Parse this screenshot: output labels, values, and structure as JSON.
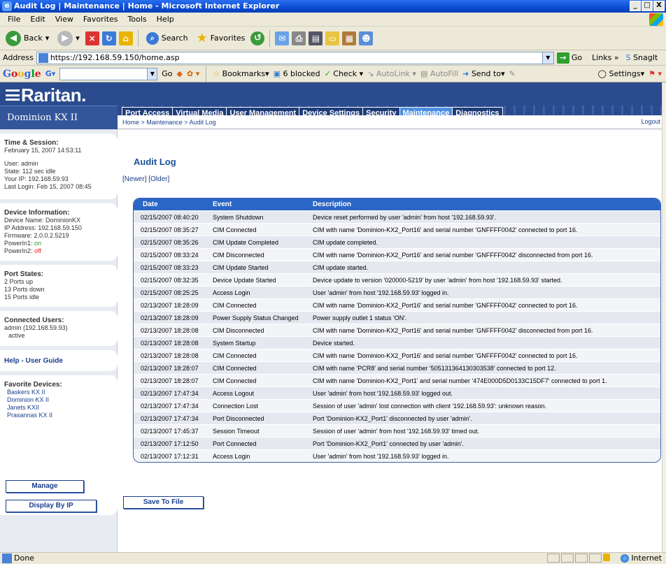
{
  "window": {
    "title": "Audit Log | Maintenance | Home - Microsoft Internet Explorer",
    "min": "_",
    "max": "□",
    "close": "X"
  },
  "menu": [
    "File",
    "Edit",
    "View",
    "Favorites",
    "Tools",
    "Help"
  ],
  "toolbar": {
    "back": "Back",
    "search": "Search",
    "favorites": "Favorites"
  },
  "address": {
    "label": "Address",
    "url": "https://192.168.59.150/home.asp",
    "go": "Go",
    "links": "Links",
    "snagit": "SnagIt"
  },
  "google_bar": {
    "logo": "Google",
    "go": "Go",
    "bookmarks": "Bookmarks▾",
    "blocked": "6 blocked",
    "check": "Check ▾",
    "autolink": "AutoLink ▾",
    "autofill": "AutoFill",
    "sendto": "Send to▾",
    "settings": "Settings▾"
  },
  "app": {
    "logo": "Raritan.",
    "product": "Dominion KX II",
    "tabs": [
      {
        "label": "Port Access",
        "active": false
      },
      {
        "label": "Virtual Media",
        "active": false
      },
      {
        "label": "User Management",
        "active": false
      },
      {
        "label": "Device Settings",
        "active": false
      },
      {
        "label": "Security",
        "active": false
      },
      {
        "label": "Maintenance",
        "active": true
      },
      {
        "label": "Diagnostics",
        "active": false
      }
    ],
    "breadcrumb": "Home > Maintenance > Audit Log",
    "logout": "Logout"
  },
  "sidebar": {
    "session": {
      "title": "Time & Session:",
      "datetime": "February 15, 2007 14:53:11",
      "user": "User: admin",
      "state": "State: 112 sec idle",
      "ip": "Your IP: 192.168.59.93",
      "last_login": "Last Login: Feb 15, 2007 08:45"
    },
    "device": {
      "title": "Device Information:",
      "name": "Device Name: DominionKX",
      "ip": "IP Address: 192.168.59.150",
      "firmware": "Firmware: 2.0.0.2.5219",
      "power1_label": "PowerIn1:",
      "power1_status": "on",
      "power2_label": "PowerIn2:",
      "power2_status": "off"
    },
    "ports": {
      "title": "Port States:",
      "up": "2 Ports up",
      "down": "13 Ports down",
      "idle": "15 Ports idle"
    },
    "users": {
      "title": "Connected Users:",
      "user": "admin (192.168.59.93)",
      "status": "active"
    },
    "help": "Help - User Guide",
    "favorites": {
      "title": "Favorite Devices:",
      "items": [
        "Baskers KX II",
        "Dominion KX II",
        "Janets KXII",
        "Prasannas KX II"
      ]
    },
    "manage": "Manage",
    "display_by_ip": "Display By IP"
  },
  "main": {
    "title": "Audit Log",
    "newer": "Newer",
    "older": "Older",
    "columns": {
      "date": "Date",
      "event": "Event",
      "description": "Description"
    },
    "rows": [
      {
        "date": "02/15/2007 08:40:20",
        "event": "System Shutdown",
        "desc": "Device reset performed by user 'admin' from host '192.168.59.93'."
      },
      {
        "date": "02/15/2007 08:35:27",
        "event": "CIM Connected",
        "desc": "CIM with name 'Dominion-KX2_Port16' and serial number 'GNFFFF0042' connected to port 16."
      },
      {
        "date": "02/15/2007 08:35:26",
        "event": "CIM Update Completed",
        "desc": "CIM update completed."
      },
      {
        "date": "02/15/2007 08:33:24",
        "event": "CIM Disconnected",
        "desc": "CIM with name 'Dominion-KX2_Port16' and serial number 'GNFFFF0042' disconnected from port 16."
      },
      {
        "date": "02/15/2007 08:33:23",
        "event": "CIM Update Started",
        "desc": "CIM update started."
      },
      {
        "date": "02/15/2007 08:32:35",
        "event": "Device Update Started",
        "desc": "Device update to version '020000-5219' by user 'admin' from host '192.168.59.93' started."
      },
      {
        "date": "02/15/2007 08:25:25",
        "event": "Access Login",
        "desc": "User 'admin' from host '192.168.59.93' logged in."
      },
      {
        "date": "02/13/2007 18:28:09",
        "event": "CIM Connected",
        "desc": "CIM with name 'Dominion-KX2_Port16' and serial number 'GNFFFF0042' connected to port 16."
      },
      {
        "date": "02/13/2007 18:28:09",
        "event": "Power Supply Status Changed",
        "desc": "Power supply outlet 1 status 'ON'."
      },
      {
        "date": "02/13/2007 18:28:08",
        "event": "CIM Disconnected",
        "desc": "CIM with name 'Dominion-KX2_Port16' and serial number 'GNFFFF0042' disconnected from port 16."
      },
      {
        "date": "02/13/2007 18:28:08",
        "event": "System Startup",
        "desc": "Device started."
      },
      {
        "date": "02/13/2007 18:28:08",
        "event": "CIM Connected",
        "desc": "CIM with name 'Dominion-KX2_Port16' and serial number 'GNFFFF0042' connected to port 16."
      },
      {
        "date": "02/13/2007 18:28:07",
        "event": "CIM Connected",
        "desc": "CIM with name 'PCR8' and serial number '505131364130303538' connected to port 12."
      },
      {
        "date": "02/13/2007 18:28:07",
        "event": "CIM Connected",
        "desc": "CIM with name 'Dominion-KX2_Port1' and serial number '474E000D5D0133C15DF7' connected to port 1."
      },
      {
        "date": "02/13/2007 17:47:34",
        "event": "Access Logout",
        "desc": "User 'admin' from host '192.168.59.93' logged out."
      },
      {
        "date": "02/13/2007 17:47:34",
        "event": "Connection Lost",
        "desc": "Session of user 'admin' lost connection with client '192.168.59.93': unknown reason."
      },
      {
        "date": "02/13/2007 17:47:34",
        "event": "Port Disconnected",
        "desc": "Port 'Dominion-KX2_Port1' disconnected by user 'admin'."
      },
      {
        "date": "02/13/2007 17:45:37",
        "event": "Session Timeout",
        "desc": "Session of user 'admin' from host '192.168.59.93' timed out."
      },
      {
        "date": "02/13/2007 17:12:50",
        "event": "Port Connected",
        "desc": "Port 'Dominion-KX2_Port1' connected by user 'admin'."
      },
      {
        "date": "02/13/2007 17:12:31",
        "event": "Access Login",
        "desc": "User 'admin' from host '192.168.59.93' logged in."
      }
    ],
    "save": "Save To File"
  },
  "status": {
    "text": "Done",
    "zone": "Internet"
  }
}
